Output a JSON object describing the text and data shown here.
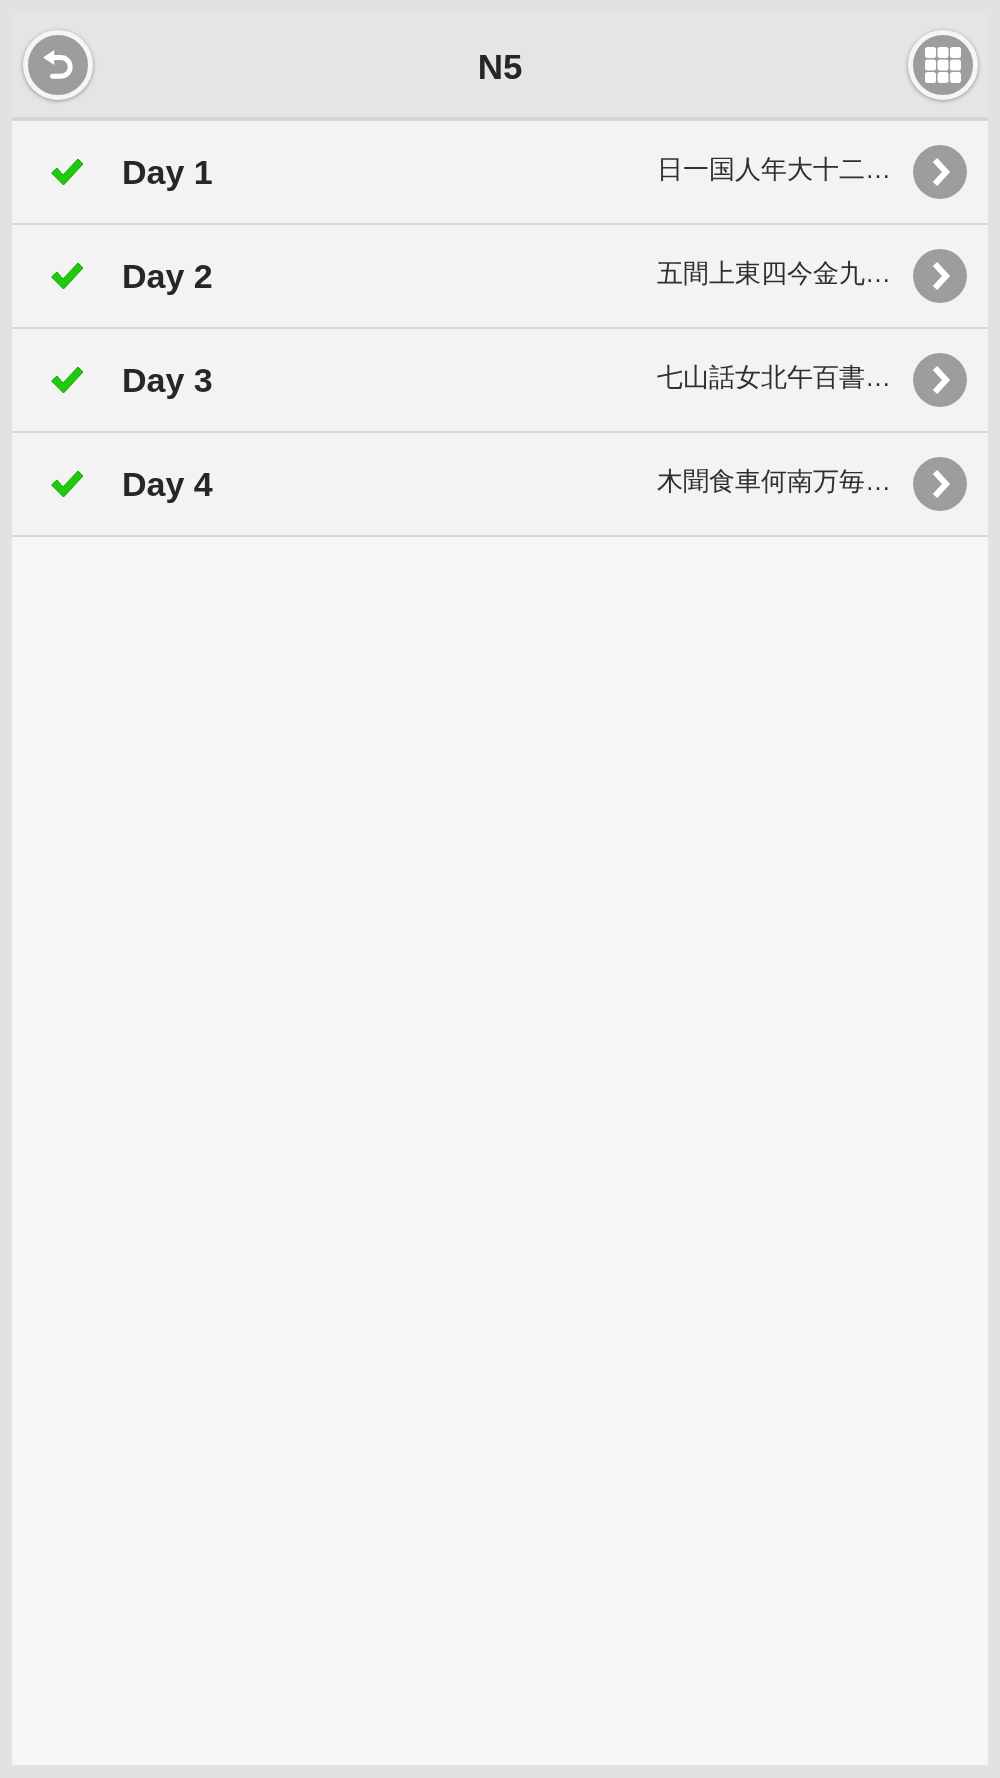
{
  "header": {
    "title": "N5"
  },
  "days": [
    {
      "label": "Day 1",
      "preview": "日一国人年大十二…",
      "done": true
    },
    {
      "label": "Day 2",
      "preview": "五間上東四今金九…",
      "done": true
    },
    {
      "label": "Day 3",
      "preview": "七山話女北午百書…",
      "done": true
    },
    {
      "label": "Day 4",
      "preview": "木聞食車何南万毎…",
      "done": true
    }
  ]
}
